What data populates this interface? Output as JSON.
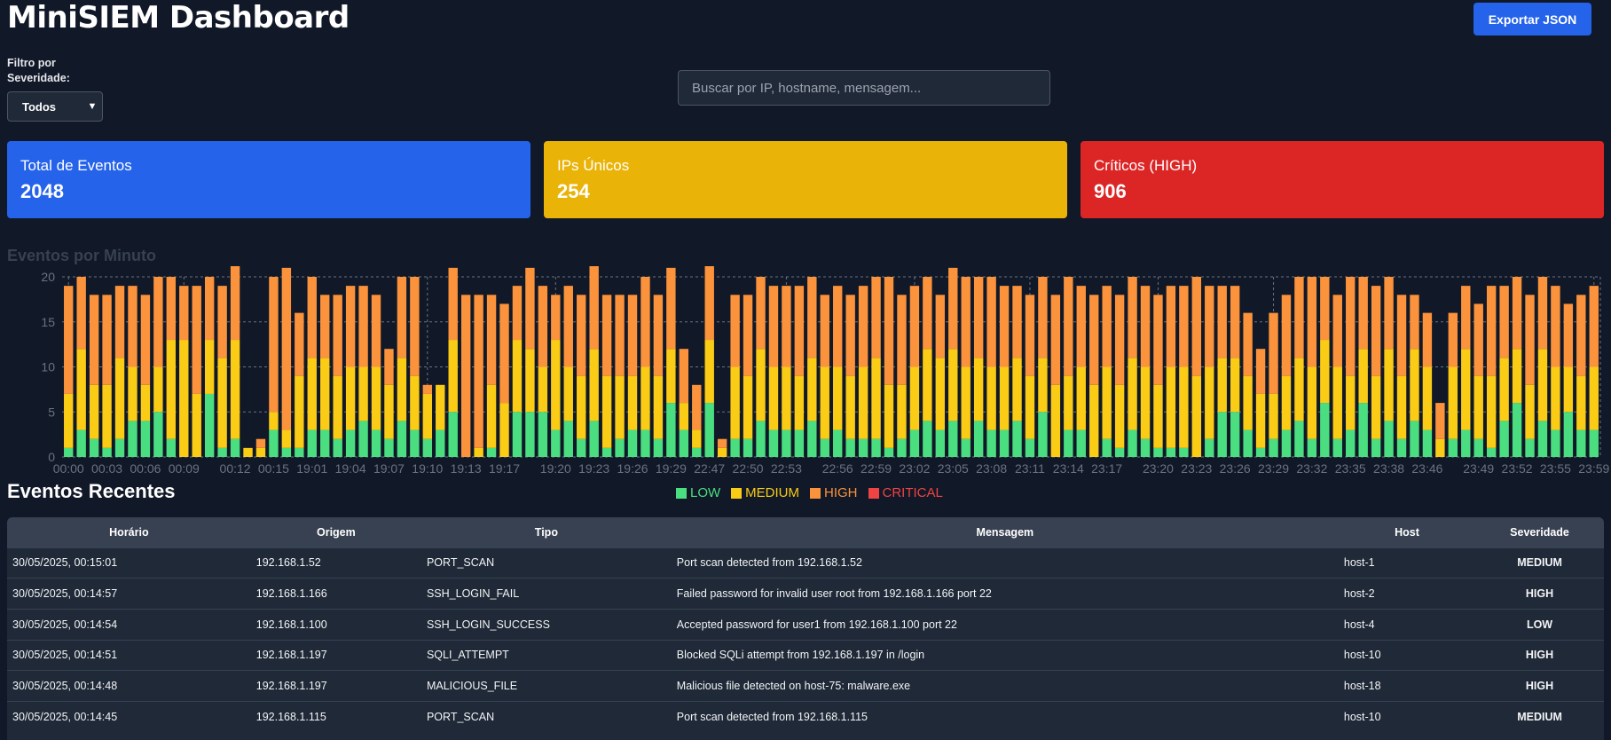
{
  "header": {
    "title": "MiniSIEM Dashboard",
    "export_label": "Exportar JSON"
  },
  "filter": {
    "label": "Filtro por Severidade:",
    "selected": "Todos"
  },
  "search": {
    "placeholder": "Buscar por IP, hostname, mensagem..."
  },
  "cards": [
    {
      "label": "Total de Eventos",
      "value": "2048",
      "color": "#2563eb"
    },
    {
      "label": "IPs Únicos",
      "value": "254",
      "color": "#eab308"
    },
    {
      "label": "Críticos (HIGH)",
      "value": "906",
      "color": "#dc2626"
    }
  ],
  "chart_data": {
    "type": "bar",
    "stacked": true,
    "title": "Eventos por Minuto",
    "ylim": [
      0,
      20
    ],
    "yticks": [
      0,
      5,
      10,
      15,
      20
    ],
    "grid": true,
    "legend_position": "bottom",
    "xtick_labels": [
      "00:00",
      "00:03",
      "00:06",
      "00:09",
      "00:12",
      "00:15",
      "19:01",
      "19:04",
      "19:07",
      "19:10",
      "19:13",
      "19:17",
      "19:20",
      "19:23",
      "19:26",
      "19:29",
      "22:47",
      "22:50",
      "22:53",
      "22:56",
      "22:59",
      "23:02",
      "23:05",
      "23:08",
      "23:11",
      "23:14",
      "23:17",
      "23:20",
      "23:23",
      "23:26",
      "23:29",
      "23:32",
      "23:35",
      "23:38",
      "23:46",
      "23:49",
      "23:52",
      "23:55",
      "23:59"
    ],
    "series": [
      {
        "name": "LOW",
        "color": "#4ade80",
        "values": [
          1,
          3,
          2,
          1,
          2,
          4,
          4,
          5,
          2,
          0,
          0,
          7,
          1,
          2,
          0,
          0,
          3,
          1,
          1,
          3,
          3,
          2,
          3,
          4,
          3,
          2,
          4,
          3,
          2,
          3,
          5,
          0,
          0,
          1,
          0,
          5,
          5,
          5,
          3,
          4,
          2,
          4,
          1,
          2,
          3,
          3,
          2,
          6,
          3,
          1,
          6,
          0,
          2,
          2,
          4,
          3,
          3,
          3,
          4,
          2,
          3,
          2,
          2,
          2,
          1,
          2,
          3,
          4,
          3,
          4,
          2,
          4,
          3,
          3,
          4,
          2,
          5,
          0,
          3,
          3,
          0,
          2,
          1,
          3,
          2,
          1,
          1,
          1,
          0,
          2,
          5,
          5,
          3,
          1,
          2,
          3,
          4,
          2,
          6,
          2,
          3,
          6,
          2,
          4,
          2,
          4,
          3,
          0,
          2,
          3,
          2,
          1,
          4,
          6,
          2,
          4,
          3,
          5,
          3,
          3
        ]
      },
      {
        "name": "MEDIUM",
        "color": "#facc15",
        "values": [
          6,
          9,
          6,
          7,
          9,
          6,
          4,
          5,
          11,
          13,
          7,
          6,
          10,
          11,
          1,
          1,
          2,
          2,
          8,
          8,
          8,
          7,
          7,
          6,
          7,
          6,
          7,
          6,
          5,
          5,
          8,
          0,
          1,
          7,
          6,
          8,
          7,
          5,
          10,
          6,
          7,
          8,
          8,
          7,
          6,
          7,
          7,
          6,
          3,
          2,
          7,
          1,
          8,
          7,
          8,
          7,
          7,
          6,
          7,
          8,
          7,
          7,
          8,
          9,
          7,
          6,
          7,
          8,
          8,
          8,
          8,
          7,
          7,
          7,
          7,
          7,
          6,
          8,
          6,
          7,
          8,
          8,
          7,
          8,
          8,
          7,
          9,
          9,
          9,
          8,
          6,
          6,
          6,
          6,
          5,
          6,
          7,
          8,
          7,
          8,
          6,
          6,
          7,
          8,
          7,
          8,
          7,
          2,
          8,
          9,
          7,
          8,
          7,
          6,
          6,
          8,
          7,
          5,
          6,
          7
        ]
      },
      {
        "name": "HIGH",
        "color": "#fb923c",
        "values": [
          12,
          8,
          10,
          10,
          8,
          9,
          10,
          10,
          7,
          6,
          12,
          7,
          8,
          9,
          0,
          1,
          15,
          18,
          7,
          9,
          7,
          9,
          9,
          9,
          8,
          4,
          9,
          11,
          1,
          0,
          8,
          18,
          17,
          10,
          11,
          6,
          9,
          9,
          5,
          9,
          9,
          10,
          9,
          9,
          9,
          10,
          9,
          9,
          6,
          5,
          9,
          1,
          8,
          9,
          8,
          9,
          9,
          10,
          9,
          8,
          9,
          9,
          9,
          9,
          12,
          10,
          9,
          8,
          7,
          9,
          10,
          9,
          10,
          9,
          8,
          9,
          9,
          10,
          11,
          9,
          10,
          9,
          10,
          9,
          9,
          10,
          9,
          9,
          11,
          9,
          8,
          8,
          7,
          5,
          9,
          9,
          9,
          10,
          7,
          8,
          11,
          8,
          10,
          8,
          9,
          6,
          6,
          4,
          6,
          7,
          8,
          10,
          8,
          8,
          10,
          8,
          9,
          7,
          9,
          9
        ]
      },
      {
        "name": "CRITICAL",
        "color": "#ef4444",
        "values": []
      }
    ]
  },
  "recent": {
    "title": "Eventos Recentes",
    "columns": [
      "Horário",
      "Origem",
      "Tipo",
      "Mensagem",
      "Host",
      "Severidade"
    ],
    "rows": [
      [
        "30/05/2025, 00:15:01",
        "192.168.1.52",
        "PORT_SCAN",
        "Port scan detected from 192.168.1.52",
        "host-1",
        "MEDIUM"
      ],
      [
        "30/05/2025, 00:14:57",
        "192.168.1.166",
        "SSH_LOGIN_FAIL",
        "Failed password for invalid user root from 192.168.1.166 port 22",
        "host-2",
        "HIGH"
      ],
      [
        "30/05/2025, 00:14:54",
        "192.168.1.100",
        "SSH_LOGIN_SUCCESS",
        "Accepted password for user1 from 192.168.1.100 port 22",
        "host-4",
        "LOW"
      ],
      [
        "30/05/2025, 00:14:51",
        "192.168.1.197",
        "SQLI_ATTEMPT",
        "Blocked SQLi attempt from 192.168.1.197 in /login",
        "host-10",
        "HIGH"
      ],
      [
        "30/05/2025, 00:14:48",
        "192.168.1.197",
        "MALICIOUS_FILE",
        "Malicious file detected on host-75: malware.exe",
        "host-18",
        "HIGH"
      ],
      [
        "30/05/2025, 00:14:45",
        "192.168.1.115",
        "PORT_SCAN",
        "Port scan detected from 192.168.1.115",
        "host-10",
        "MEDIUM"
      ]
    ]
  }
}
